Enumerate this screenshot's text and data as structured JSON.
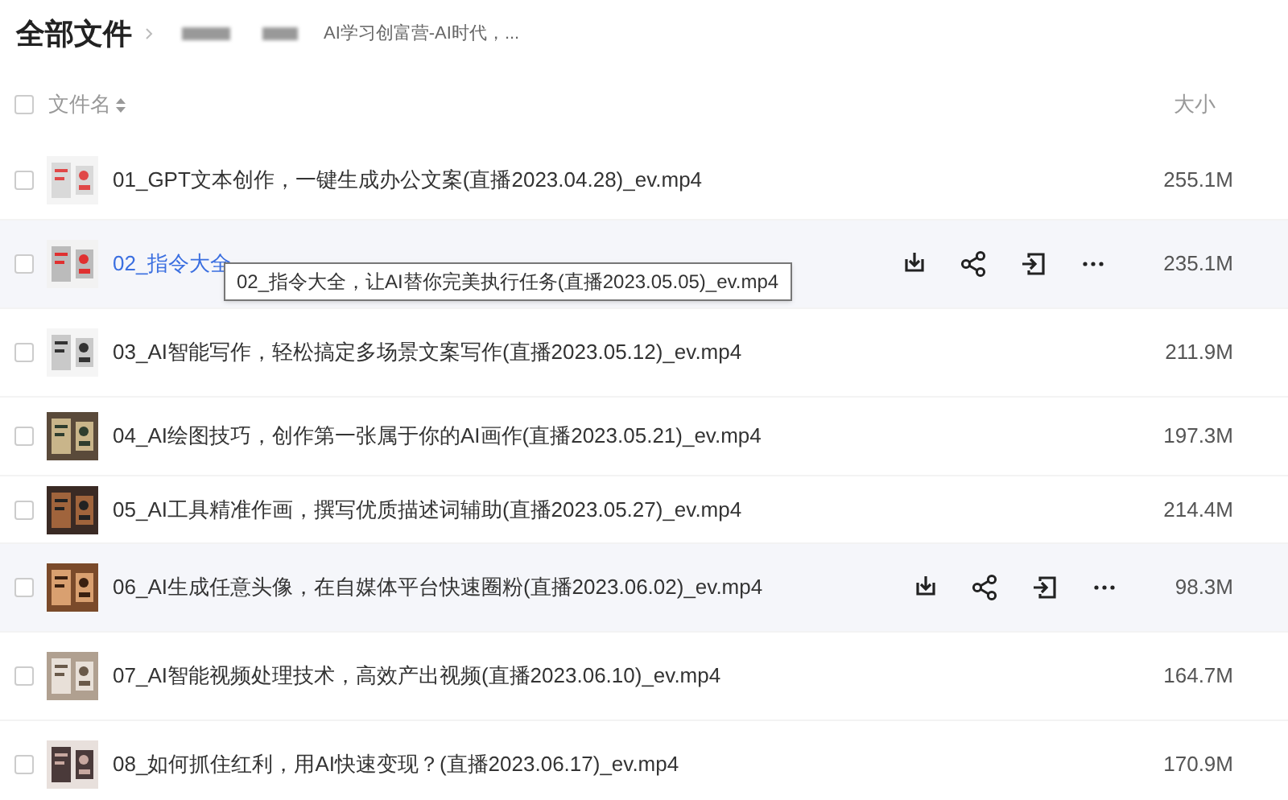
{
  "header": {
    "title": "全部文件",
    "breadcrumb_current": "AI学习创富营-AI时代，..."
  },
  "table": {
    "all_checked": false,
    "columns": [
      {
        "label": "文件名",
        "sortable": true
      },
      {
        "label": "大小",
        "sortable": false
      }
    ],
    "rows": [
      {
        "name": "01_GPT文本创作，一键生成办公文案(直播2023.04.28)_ev.mp4",
        "size": "255.1M",
        "hovered": false,
        "checked": false
      },
      {
        "name": "02_指令大全",
        "size": "235.1M",
        "hovered": true,
        "checked": false,
        "tooltip": "02_指令大全，让AI替你完美执行任务(直播2023.05.05)_ev.mp4"
      },
      {
        "name": "03_AI智能写作，轻松搞定多场景文案写作(直播2023.05.12)_ev.mp4",
        "size": "211.9M",
        "hovered": false,
        "checked": false
      },
      {
        "name": "04_AI绘图技巧，创作第一张属于你的AI画作(直播2023.05.21)_ev.mp4",
        "size": "197.3M",
        "hovered": false,
        "checked": false
      },
      {
        "name": "05_AI工具精准作画，撰写优质描述词辅助(直播2023.05.27)_ev.mp4",
        "size": "214.4M",
        "hovered": false,
        "checked": false
      },
      {
        "name": "06_AI生成任意头像，在自媒体平台快速圈粉(直播2023.06.02)_ev.mp4",
        "size": "98.3M",
        "hovered": true,
        "checked": false
      },
      {
        "name": "07_AI智能视频处理技术，高效产出视频(直播2023.06.10)_ev.mp4",
        "size": "164.7M",
        "hovered": false,
        "checked": false
      },
      {
        "name": "08_如何抓住红利，用AI快速变现？(直播2023.06.17)_ev.mp4",
        "size": "170.9M",
        "hovered": false,
        "checked": false
      }
    ]
  }
}
